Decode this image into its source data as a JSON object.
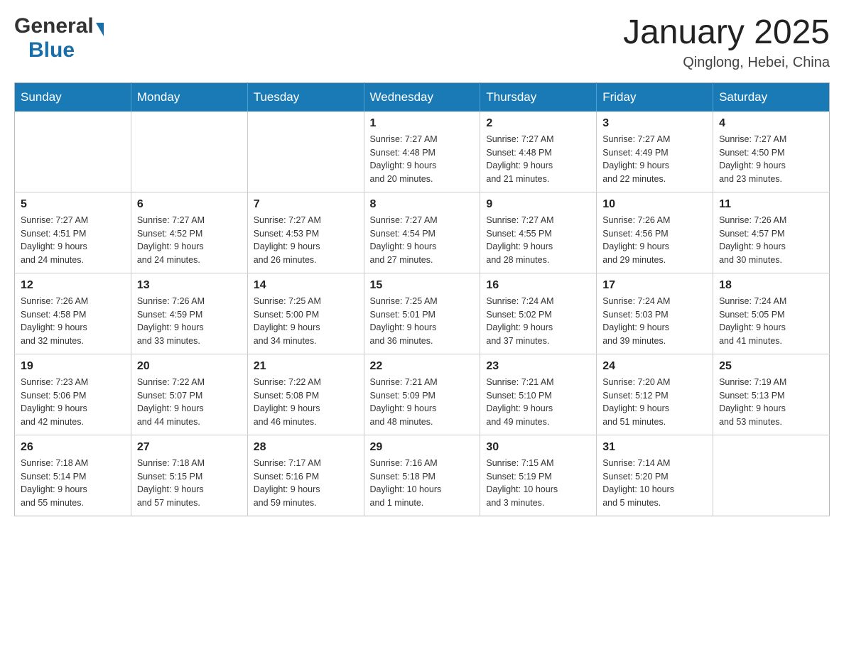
{
  "header": {
    "logo_general": "General",
    "logo_blue": "Blue",
    "month_title": "January 2025",
    "location": "Qinglong, Hebei, China"
  },
  "weekdays": [
    "Sunday",
    "Monday",
    "Tuesday",
    "Wednesday",
    "Thursday",
    "Friday",
    "Saturday"
  ],
  "weeks": [
    [
      {
        "day": "",
        "info": ""
      },
      {
        "day": "",
        "info": ""
      },
      {
        "day": "",
        "info": ""
      },
      {
        "day": "1",
        "info": "Sunrise: 7:27 AM\nSunset: 4:48 PM\nDaylight: 9 hours\nand 20 minutes."
      },
      {
        "day": "2",
        "info": "Sunrise: 7:27 AM\nSunset: 4:48 PM\nDaylight: 9 hours\nand 21 minutes."
      },
      {
        "day": "3",
        "info": "Sunrise: 7:27 AM\nSunset: 4:49 PM\nDaylight: 9 hours\nand 22 minutes."
      },
      {
        "day": "4",
        "info": "Sunrise: 7:27 AM\nSunset: 4:50 PM\nDaylight: 9 hours\nand 23 minutes."
      }
    ],
    [
      {
        "day": "5",
        "info": "Sunrise: 7:27 AM\nSunset: 4:51 PM\nDaylight: 9 hours\nand 24 minutes."
      },
      {
        "day": "6",
        "info": "Sunrise: 7:27 AM\nSunset: 4:52 PM\nDaylight: 9 hours\nand 24 minutes."
      },
      {
        "day": "7",
        "info": "Sunrise: 7:27 AM\nSunset: 4:53 PM\nDaylight: 9 hours\nand 26 minutes."
      },
      {
        "day": "8",
        "info": "Sunrise: 7:27 AM\nSunset: 4:54 PM\nDaylight: 9 hours\nand 27 minutes."
      },
      {
        "day": "9",
        "info": "Sunrise: 7:27 AM\nSunset: 4:55 PM\nDaylight: 9 hours\nand 28 minutes."
      },
      {
        "day": "10",
        "info": "Sunrise: 7:26 AM\nSunset: 4:56 PM\nDaylight: 9 hours\nand 29 minutes."
      },
      {
        "day": "11",
        "info": "Sunrise: 7:26 AM\nSunset: 4:57 PM\nDaylight: 9 hours\nand 30 minutes."
      }
    ],
    [
      {
        "day": "12",
        "info": "Sunrise: 7:26 AM\nSunset: 4:58 PM\nDaylight: 9 hours\nand 32 minutes."
      },
      {
        "day": "13",
        "info": "Sunrise: 7:26 AM\nSunset: 4:59 PM\nDaylight: 9 hours\nand 33 minutes."
      },
      {
        "day": "14",
        "info": "Sunrise: 7:25 AM\nSunset: 5:00 PM\nDaylight: 9 hours\nand 34 minutes."
      },
      {
        "day": "15",
        "info": "Sunrise: 7:25 AM\nSunset: 5:01 PM\nDaylight: 9 hours\nand 36 minutes."
      },
      {
        "day": "16",
        "info": "Sunrise: 7:24 AM\nSunset: 5:02 PM\nDaylight: 9 hours\nand 37 minutes."
      },
      {
        "day": "17",
        "info": "Sunrise: 7:24 AM\nSunset: 5:03 PM\nDaylight: 9 hours\nand 39 minutes."
      },
      {
        "day": "18",
        "info": "Sunrise: 7:24 AM\nSunset: 5:05 PM\nDaylight: 9 hours\nand 41 minutes."
      }
    ],
    [
      {
        "day": "19",
        "info": "Sunrise: 7:23 AM\nSunset: 5:06 PM\nDaylight: 9 hours\nand 42 minutes."
      },
      {
        "day": "20",
        "info": "Sunrise: 7:22 AM\nSunset: 5:07 PM\nDaylight: 9 hours\nand 44 minutes."
      },
      {
        "day": "21",
        "info": "Sunrise: 7:22 AM\nSunset: 5:08 PM\nDaylight: 9 hours\nand 46 minutes."
      },
      {
        "day": "22",
        "info": "Sunrise: 7:21 AM\nSunset: 5:09 PM\nDaylight: 9 hours\nand 48 minutes."
      },
      {
        "day": "23",
        "info": "Sunrise: 7:21 AM\nSunset: 5:10 PM\nDaylight: 9 hours\nand 49 minutes."
      },
      {
        "day": "24",
        "info": "Sunrise: 7:20 AM\nSunset: 5:12 PM\nDaylight: 9 hours\nand 51 minutes."
      },
      {
        "day": "25",
        "info": "Sunrise: 7:19 AM\nSunset: 5:13 PM\nDaylight: 9 hours\nand 53 minutes."
      }
    ],
    [
      {
        "day": "26",
        "info": "Sunrise: 7:18 AM\nSunset: 5:14 PM\nDaylight: 9 hours\nand 55 minutes."
      },
      {
        "day": "27",
        "info": "Sunrise: 7:18 AM\nSunset: 5:15 PM\nDaylight: 9 hours\nand 57 minutes."
      },
      {
        "day": "28",
        "info": "Sunrise: 7:17 AM\nSunset: 5:16 PM\nDaylight: 9 hours\nand 59 minutes."
      },
      {
        "day": "29",
        "info": "Sunrise: 7:16 AM\nSunset: 5:18 PM\nDaylight: 10 hours\nand 1 minute."
      },
      {
        "day": "30",
        "info": "Sunrise: 7:15 AM\nSunset: 5:19 PM\nDaylight: 10 hours\nand 3 minutes."
      },
      {
        "day": "31",
        "info": "Sunrise: 7:14 AM\nSunset: 5:20 PM\nDaylight: 10 hours\nand 5 minutes."
      },
      {
        "day": "",
        "info": ""
      }
    ]
  ]
}
